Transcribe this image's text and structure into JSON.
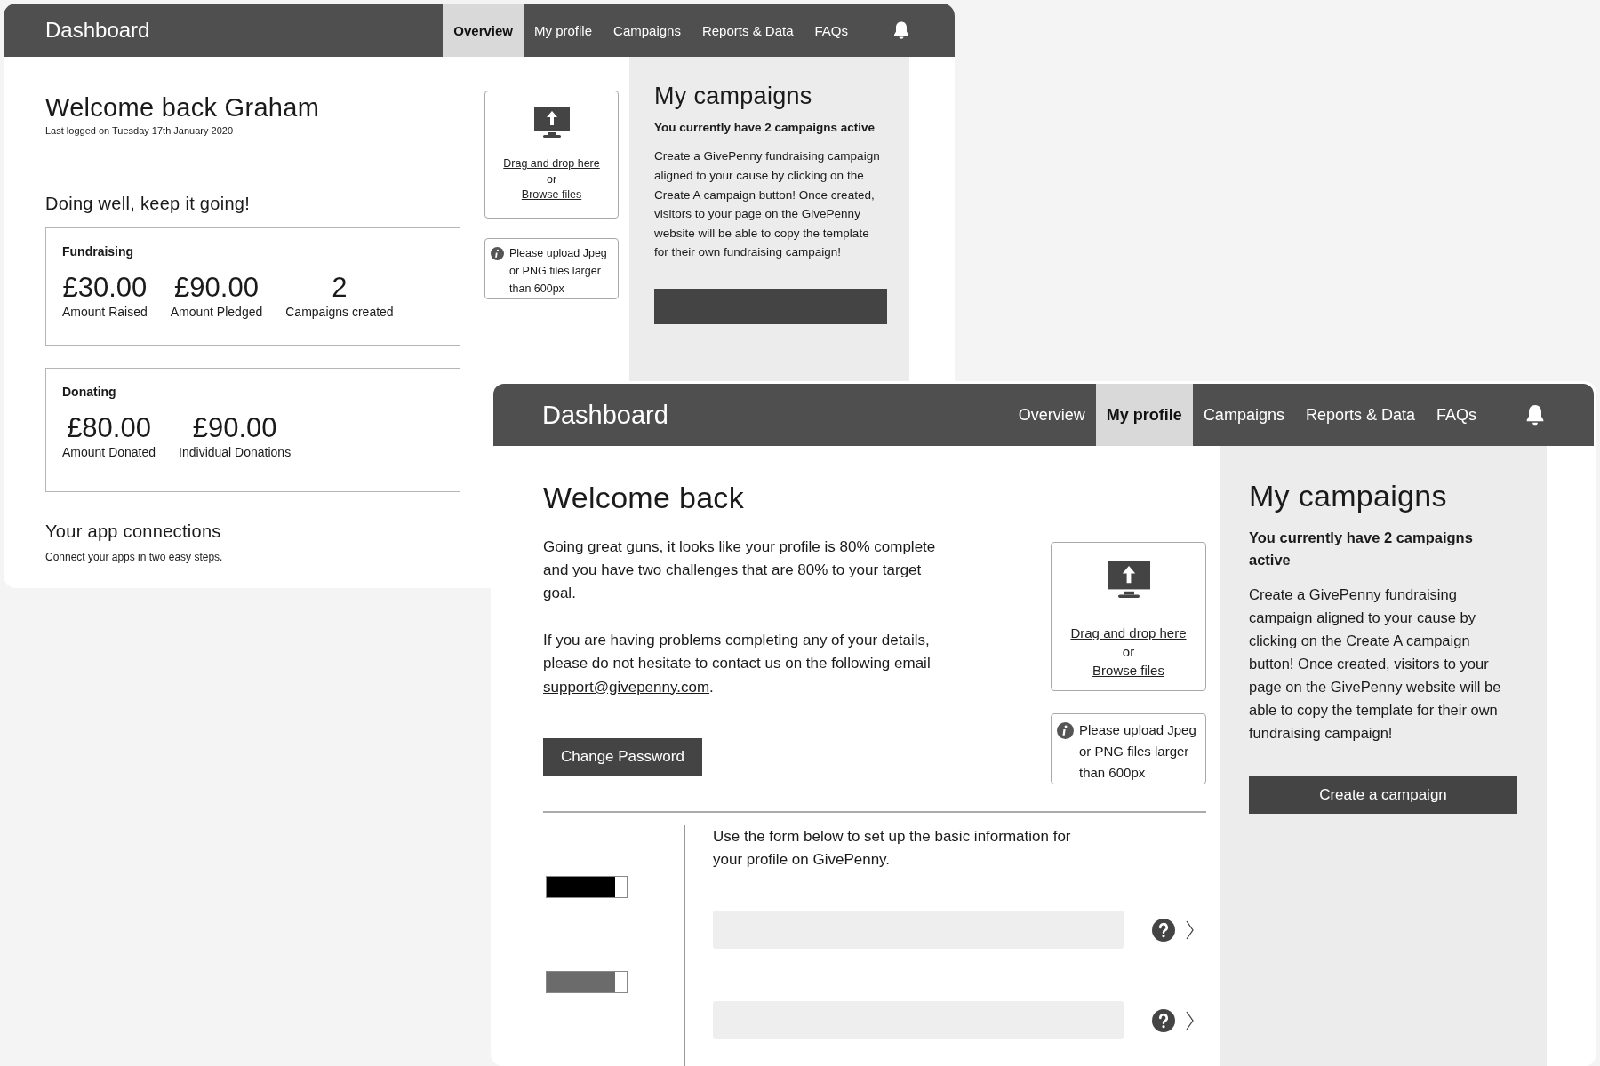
{
  "overview_window": {
    "title": "Dashboard",
    "tabs": [
      {
        "label": "Overview",
        "selected": true
      },
      {
        "label": "My profile",
        "selected": false
      },
      {
        "label": "Campaigns",
        "selected": false
      },
      {
        "label": "Reports & Data",
        "selected": false
      },
      {
        "label": "FAQs",
        "selected": false
      }
    ],
    "heading": "Welcome back Graham",
    "last_logged": "Last logged on Tuesday 17th January 2020",
    "subheading": "Doing well, keep it going!",
    "stat_cards": [
      {
        "title": "Fundraising",
        "stats": [
          {
            "value": "£30.00",
            "label": "Amount Raised"
          },
          {
            "value": "£90.00",
            "label": "Amount Pledged"
          },
          {
            "value": "2",
            "label": "Campaigns created"
          }
        ]
      },
      {
        "title": "Donating",
        "stats": [
          {
            "value": "£80.00",
            "label": "Amount Donated"
          },
          {
            "value": "£90.00",
            "label": "Individual Donations"
          }
        ]
      }
    ],
    "app_connections": {
      "heading": "Your app connections",
      "text": "Connect your apps in two easy steps."
    },
    "upload": {
      "drop_link": "Drag and drop here",
      "or": "or",
      "browse_link": "Browse files"
    },
    "upload_note": "Please upload Jpeg or PNG files larger than 600px",
    "campaigns": {
      "heading": "My campaigns",
      "summary": "You currently have 2 campaigns active",
      "body": "Create a GivePenny fundraising campaign aligned to your cause by clicking on the Create A campaign button! Once created, visitors to your page on the GivePenny website will be able to copy the template for their own fundraising campaign!"
    }
  },
  "profile_window": {
    "title": "Dashboard",
    "tabs": [
      {
        "label": "Overview",
        "selected": false
      },
      {
        "label": "My profile",
        "selected": true
      },
      {
        "label": "Campaigns",
        "selected": false
      },
      {
        "label": "Reports & Data",
        "selected": false
      },
      {
        "label": "FAQs",
        "selected": false
      }
    ],
    "heading": "Welcome back",
    "intro": "Going great guns, it looks like your profile is 80% complete and you have two challenges that are 80% to your target goal.",
    "contact": {
      "text": "If you are having problems completing any of your details, please do not hesitate to contact us on the following email",
      "link": "support@givepenny.com",
      "after": "."
    },
    "change_password_button": "Change Password",
    "upload": {
      "drop_link": "Drag and drop here",
      "or": "or",
      "browse_link": "Browse files"
    },
    "upload_note": "Please upload Jpeg or PNG files larger than 600px",
    "form": {
      "intro": "Use the form below to set up the basic information for your profile on GivePenny.",
      "progress": [
        {
          "level": 0.86,
          "color": "#000000"
        },
        {
          "level": 0.86,
          "color": "#6b6b6b"
        }
      ],
      "fields": [
        {
          "help": true
        },
        {
          "help": true
        }
      ]
    },
    "campaigns": {
      "heading": "My campaigns",
      "summary": "You currently have 2 campaigns active",
      "body": "Create a GivePenny fundraising campaign aligned to your cause by clicking on the Create A campaign button! Once created, visitors to your page on the GivePenny website will be able to copy the template for their own fundraising campaign!",
      "button": "Create a campaign"
    }
  }
}
